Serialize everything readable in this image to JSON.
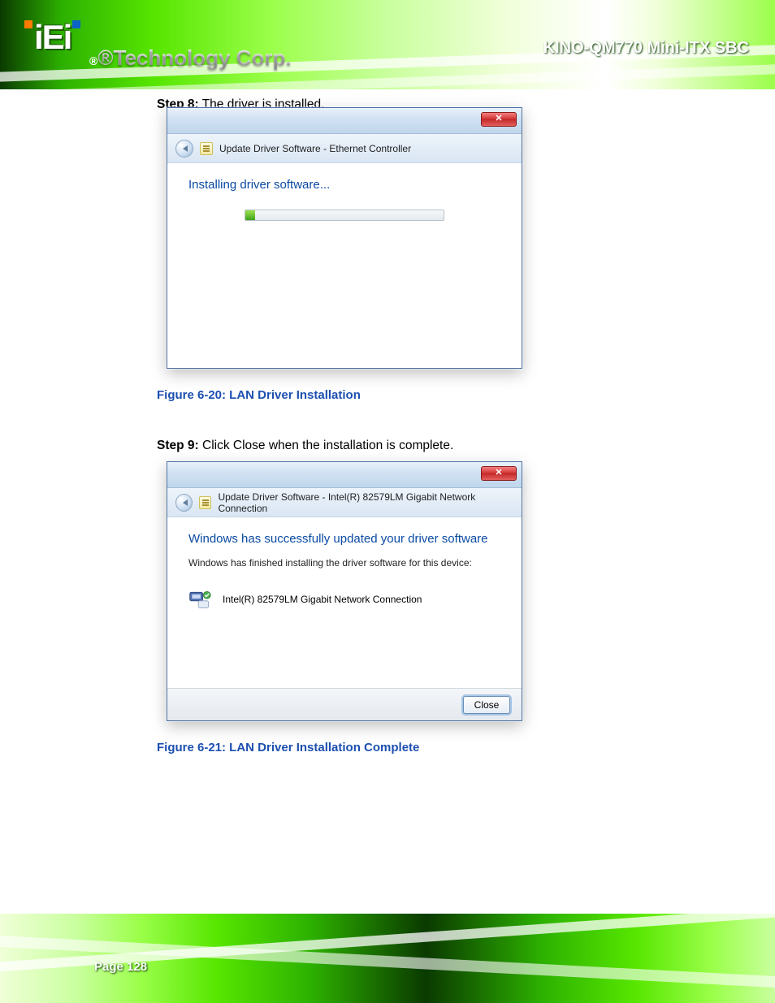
{
  "header": {
    "brand_letters": "iEi",
    "brand_tag": "®Technology Corp.",
    "doc_title": "KINO-QM770 Mini-ITX SBC"
  },
  "step8": {
    "prefix": "Step 8:",
    "text": "The driver is installed."
  },
  "step9": {
    "prefix": "Step 9:",
    "text": "Click Close when the installation is complete."
  },
  "caption1": "Figure 6-20: LAN Driver Installation",
  "caption2": "Figure 6-21: LAN Driver Installation Complete",
  "dialog1": {
    "close_glyph": "✕",
    "title": "Update Driver Software - Ethernet Controller",
    "heading": "Installing driver software..."
  },
  "dialog2": {
    "close_glyph": "✕",
    "title": "Update Driver Software - Intel(R) 82579LM Gigabit Network Connection",
    "heading": "Windows has successfully updated your driver software",
    "body": "Windows has finished installing the driver software for this device:",
    "device": "Intel(R) 82579LM Gigabit Network Connection",
    "close_btn": "Close"
  },
  "page_number": "Page 128"
}
